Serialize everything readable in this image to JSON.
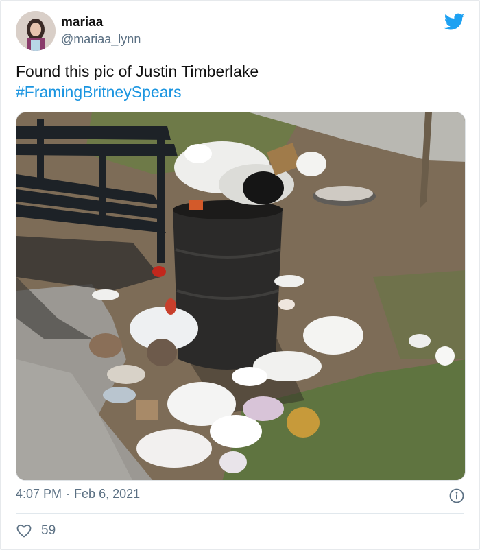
{
  "author": {
    "name": "mariaa",
    "handle": "@mariaa_lynn"
  },
  "tweet": {
    "text": "Found this pic of Justin Timberlake",
    "hashtag": "#FramingBritneySpears"
  },
  "timestamp": {
    "time": "4:07 PM",
    "separator": "·",
    "date": "Feb 6, 2021"
  },
  "engagement": {
    "likes": "59"
  },
  "icons": {
    "brand": "twitter-bird-icon",
    "info": "info-icon",
    "like": "heart-icon"
  },
  "colors": {
    "accent": "#1da1f2",
    "link": "#1b95e0",
    "muted": "#5b7083"
  }
}
